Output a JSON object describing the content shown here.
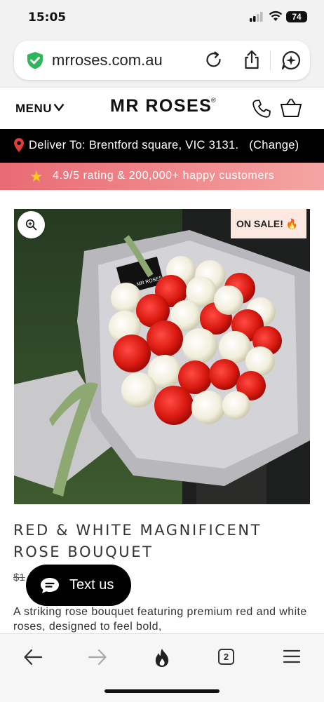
{
  "status_bar": {
    "time": "15:05",
    "battery": "74"
  },
  "browser": {
    "url": "mrroses.com.au"
  },
  "header": {
    "menu_label": "MENU",
    "logo": "MR ROSES",
    "logo_mark": "®"
  },
  "delivery": {
    "text": "Deliver To: Brentford square, VIC 3131.",
    "change_label": "(Change)"
  },
  "rating_banner": {
    "text": "4.9/5 rating & 200,000+ happy customers"
  },
  "product": {
    "sale_badge": "ON SALE! 🔥",
    "title": "RED & WHITE MAGNIFICENT ROSE BOUQUET",
    "old_price": "$1",
    "description": "A striking rose bouquet featuring premium red and white roses, designed to feel bold,",
    "bouquet_tag": "MR ROSES"
  },
  "chat_widget": {
    "label": "Text us"
  },
  "bottom_nav": {
    "tab_count": "2"
  },
  "icons": [
    "shield-check-icon",
    "reload-icon",
    "share-icon",
    "chat-spark-icon",
    "chevron-down-icon",
    "phone-icon",
    "shopping-bag-icon",
    "location-pin-icon",
    "star-icon",
    "zoom-icon",
    "fire-icon",
    "back-icon",
    "forward-icon",
    "tabs-icon",
    "hamburger-icon"
  ],
  "colors": {
    "accent_pink": "#ee7d82",
    "delivery_bg": "#000000",
    "pin_red": "#e23b3b",
    "sale_bg": "#fbe8e0"
  }
}
